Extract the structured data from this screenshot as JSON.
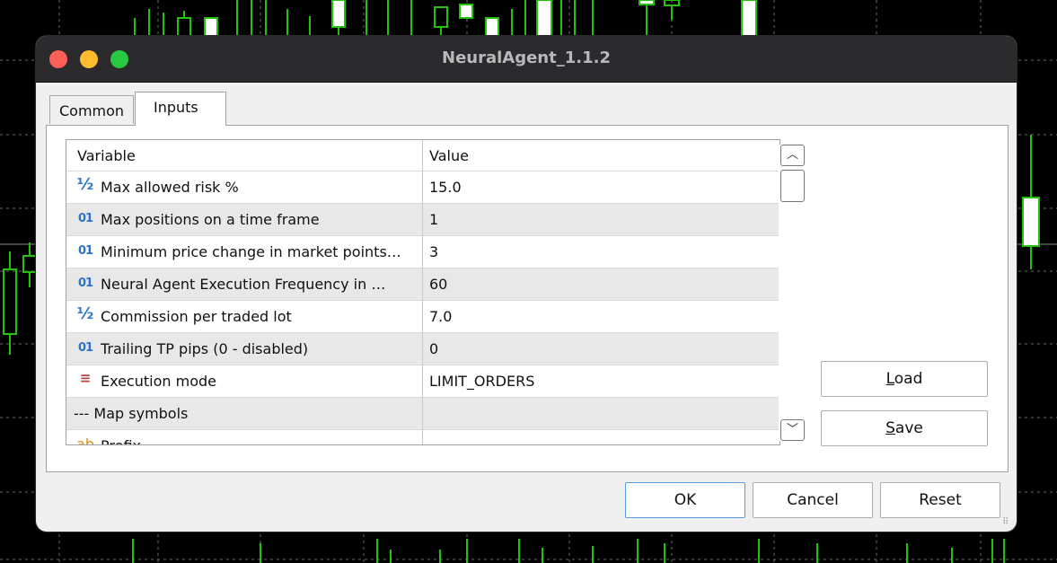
{
  "window": {
    "title": "NeuralAgent_1.1.2"
  },
  "tabs": [
    {
      "label": "Common",
      "active": false
    },
    {
      "label": "Inputs",
      "active": true
    }
  ],
  "grid": {
    "columns": [
      "Variable",
      "Value"
    ],
    "rows": [
      {
        "icon": "half-icon",
        "glyph": "½",
        "name": "Max allowed risk %",
        "value": "15.0"
      },
      {
        "icon": "integer-icon",
        "glyph": "01",
        "name": "Max positions on a time frame",
        "value": "1"
      },
      {
        "icon": "integer-icon",
        "glyph": "01",
        "name": "Minimum price change in market points…",
        "value": "3"
      },
      {
        "icon": "integer-icon",
        "glyph": "01",
        "name": "Neural Agent Execution Frequency in …",
        "value": "60"
      },
      {
        "icon": "half-icon",
        "glyph": "½",
        "name": "Commission per traded lot",
        "value": "7.0"
      },
      {
        "icon": "integer-icon",
        "glyph": "01",
        "name": "Trailing TP pips (0 - disabled)",
        "value": "0"
      },
      {
        "icon": "enum-icon",
        "glyph": "≡",
        "name": "Execution mode",
        "value": "LIMIT_ORDERS"
      },
      {
        "icon": "",
        "glyph": "",
        "name": "--- Map symbols",
        "value": ""
      },
      {
        "icon": "string-icon",
        "glyph": "ab",
        "name": "Prefix",
        "value": ""
      }
    ]
  },
  "buttons": {
    "load": {
      "mnemonic": "L",
      "rest": "oad"
    },
    "save": {
      "mnemonic": "S",
      "rest": "ave"
    },
    "ok": "OK",
    "cancel": "Cancel",
    "reset": "Reset"
  },
  "colors": {
    "background": "#000000",
    "candle_green": "#22c10a",
    "dialog": "#f0f0f0",
    "titlebar": "#2b2b2d",
    "icon_blue": "#2f73c9"
  }
}
